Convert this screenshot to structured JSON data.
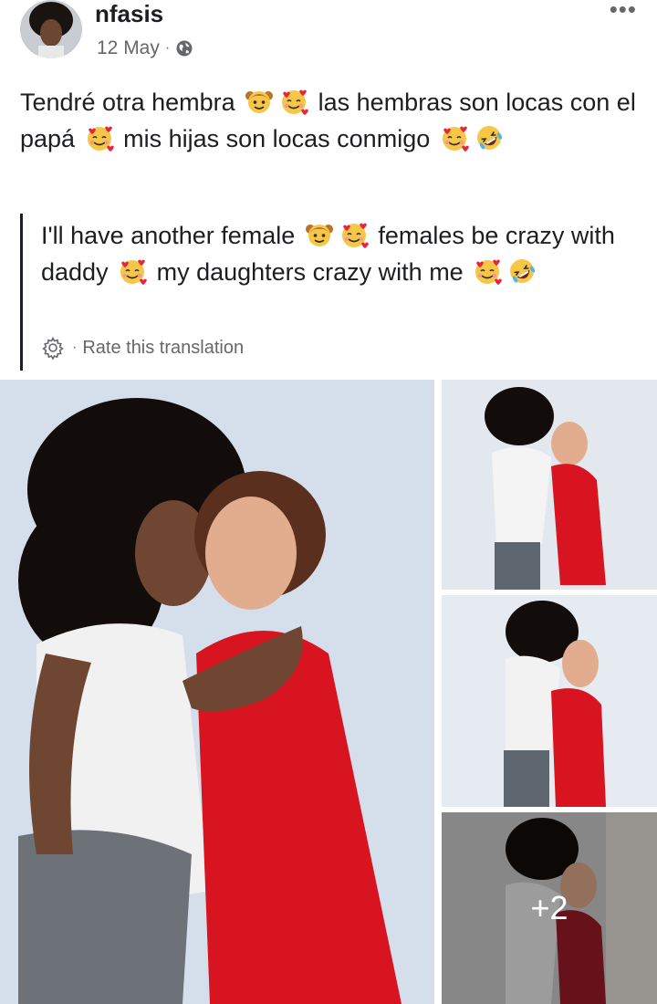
{
  "post": {
    "author": "nfasis",
    "date": "12 May",
    "separator": "·",
    "privacy_icon": "globe-icon",
    "more_icon": "more-dots-icon",
    "more_glyph": "•••"
  },
  "content": {
    "original": [
      {
        "type": "text",
        "value": "Tendré otra hembra "
      },
      {
        "type": "emoji",
        "name": "girl-face-emoji"
      },
      {
        "type": "emoji",
        "name": "smiling-face-with-hearts-emoji"
      },
      {
        "type": "text",
        "value": " las hembras son locas con el papá "
      },
      {
        "type": "emoji",
        "name": "smiling-face-with-hearts-emoji"
      },
      {
        "type": "text",
        "value": " mis hijas son locas conmigo "
      },
      {
        "type": "emoji",
        "name": "smiling-face-with-hearts-emoji"
      },
      {
        "type": "emoji",
        "name": "rolling-laughing-emoji"
      }
    ],
    "translation": [
      {
        "type": "text",
        "value": "I'll have another female "
      },
      {
        "type": "emoji",
        "name": "girl-face-emoji"
      },
      {
        "type": "emoji",
        "name": "smiling-face-with-hearts-emoji"
      },
      {
        "type": "text",
        "value": " females be crazy with daddy "
      },
      {
        "type": "emoji",
        "name": "smiling-face-with-hearts-emoji"
      },
      {
        "type": "text",
        "value": " my daughters crazy with me "
      },
      {
        "type": "emoji",
        "name": "smiling-face-with-hearts-emoji"
      },
      {
        "type": "emoji",
        "name": "rolling-laughing-emoji"
      }
    ],
    "rate_translation": "Rate this translation",
    "rate_separator": "·"
  },
  "photos": {
    "extra_count": "+2"
  },
  "colors": {
    "text": "#1c1e21",
    "secondary": "#65676b",
    "dress_red": "#d7141f"
  }
}
